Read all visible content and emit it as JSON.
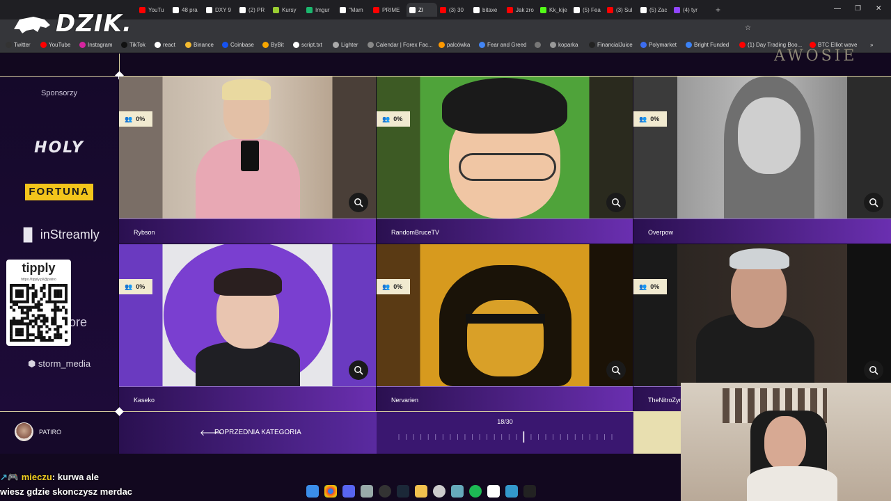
{
  "browser": {
    "tabs": [
      {
        "label": "YouTu",
        "color": "#ff0000"
      },
      {
        "label": "48 pra",
        "color": "#ffffff"
      },
      {
        "label": "DXY 9",
        "color": "#ffffff"
      },
      {
        "label": "(2) PR",
        "color": "#ffffff"
      },
      {
        "label": "Kursy",
        "color": "#9acd32"
      },
      {
        "label": "Imgur",
        "color": "#1bb76e"
      },
      {
        "label": "\"Mam",
        "color": "#ffffff"
      },
      {
        "label": "PRIME",
        "color": "#ff0000"
      },
      {
        "label": "Zl",
        "color": "#ffffff",
        "active": true
      },
      {
        "label": "(3) 30",
        "color": "#ff0000"
      },
      {
        "label": "bitaxe",
        "color": "#ffffff"
      },
      {
        "label": "Jak zro",
        "color": "#ff0000"
      },
      {
        "label": "Kk_kije",
        "color": "#53fc18"
      },
      {
        "label": "(5) Fea",
        "color": "#ffffff"
      },
      {
        "label": "(3) Sul",
        "color": "#ff0000"
      },
      {
        "label": "(5) Zac",
        "color": "#ffffff"
      },
      {
        "label": "(4) tyr",
        "color": "#9146ff"
      }
    ],
    "new_tab": "+",
    "bookmarks": [
      "Twitter",
      "YouTube",
      "Instagram",
      "TikTok",
      "react",
      "Binance",
      "Coinbase",
      "ByBit",
      "script.txt",
      "Lighter",
      "Calendar | Forex Fac...",
      "palcówka",
      "Fear and Greed",
      "",
      "koparka",
      "FinancialJuice",
      "Polymarket",
      "Bright Funded",
      "(1) Day Trading Boo...",
      "BTC Elliot wave"
    ],
    "more": "»"
  },
  "overlay": {
    "logo": "DZIK.",
    "tipply_title": "tipply",
    "tipply_url": "https://tipply.pl/@patiro",
    "chat_line1_user": "mieczu",
    "chat_line1_text": ": kurwa ale",
    "chat_line2_text": "wiesz gdzie skonczysz merdac"
  },
  "page": {
    "wordmark": "AWOSIE",
    "sponsors_title": "Sponsorzy",
    "sponsors": [
      "HOLY",
      "FORTUNA",
      "inStreamly",
      "store",
      "storm_media"
    ],
    "nominees": [
      {
        "name": "Rybson",
        "percent": "0%"
      },
      {
        "name": "RandomBruceTV",
        "percent": "0%"
      },
      {
        "name": "Overpow",
        "percent": "0%"
      },
      {
        "name": "Kaseko",
        "percent": "0%"
      },
      {
        "name": "Nervarien",
        "percent": "0%"
      },
      {
        "name": "TheNitroZyniak",
        "percent": "0%"
      }
    ],
    "user": "PATIRO",
    "prev_category": "POPRZEDNIA KATEGORIA",
    "progress_text": "18/30",
    "progress_value": 18,
    "progress_total": 30
  },
  "colors": {
    "accent": "#6a2fb0",
    "badge_bg": "#f1ead0",
    "gold_line": "#d9cfa0",
    "fortuna": "#f3c51b"
  }
}
